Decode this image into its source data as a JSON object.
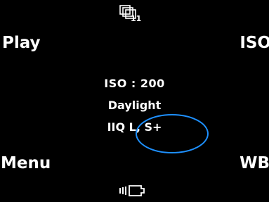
{
  "softkeys": {
    "top_left": "Play",
    "top_right": "ISO",
    "bottom_left": "Menu",
    "bottom_right": "WB"
  },
  "status": {
    "iso": "ISO : 200",
    "white_balance": "Daylight",
    "format": "IIQ L, S+"
  },
  "top_indicator": {
    "icon": "frames-icon",
    "count": "11"
  },
  "bottom_indicator": {
    "icon": "battery-icon"
  },
  "colors": {
    "background": "#000000",
    "text": "#ffffff",
    "highlight": "#1e90ff"
  }
}
